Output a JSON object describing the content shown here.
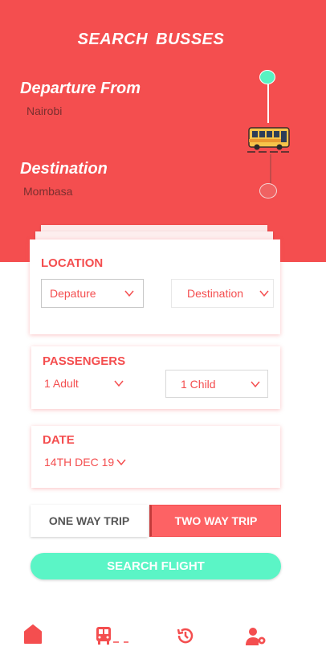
{
  "hero": {
    "title": "SEARCH  BUSSES",
    "departure_label": "Departure From",
    "departure_value": "Nairobi",
    "destination_label": "Destination",
    "destination_value": "Mombasa"
  },
  "location": {
    "title": "LOCATION",
    "from_select": "Depature",
    "to_select": "Destination"
  },
  "passengers": {
    "title": "PASSENGERS",
    "adults": "1 Adult",
    "children": "1 Child"
  },
  "date": {
    "title": "DATE",
    "value": "14TH DEC 19"
  },
  "trip": {
    "one_way": "ONE WAY TRIP",
    "two_way": "TWO WAY TRIP",
    "selected": "TWO WAY TRIP"
  },
  "search_button": "SEARCH FLIGHT",
  "colors": {
    "primary": "#f44e4f",
    "accent": "#5bf5c6",
    "selected_trip": "#fd6264"
  },
  "nav": {
    "icons": [
      "home-icon",
      "bus-icon",
      "history-icon",
      "user-settings-icon"
    ],
    "active": "home-icon"
  }
}
